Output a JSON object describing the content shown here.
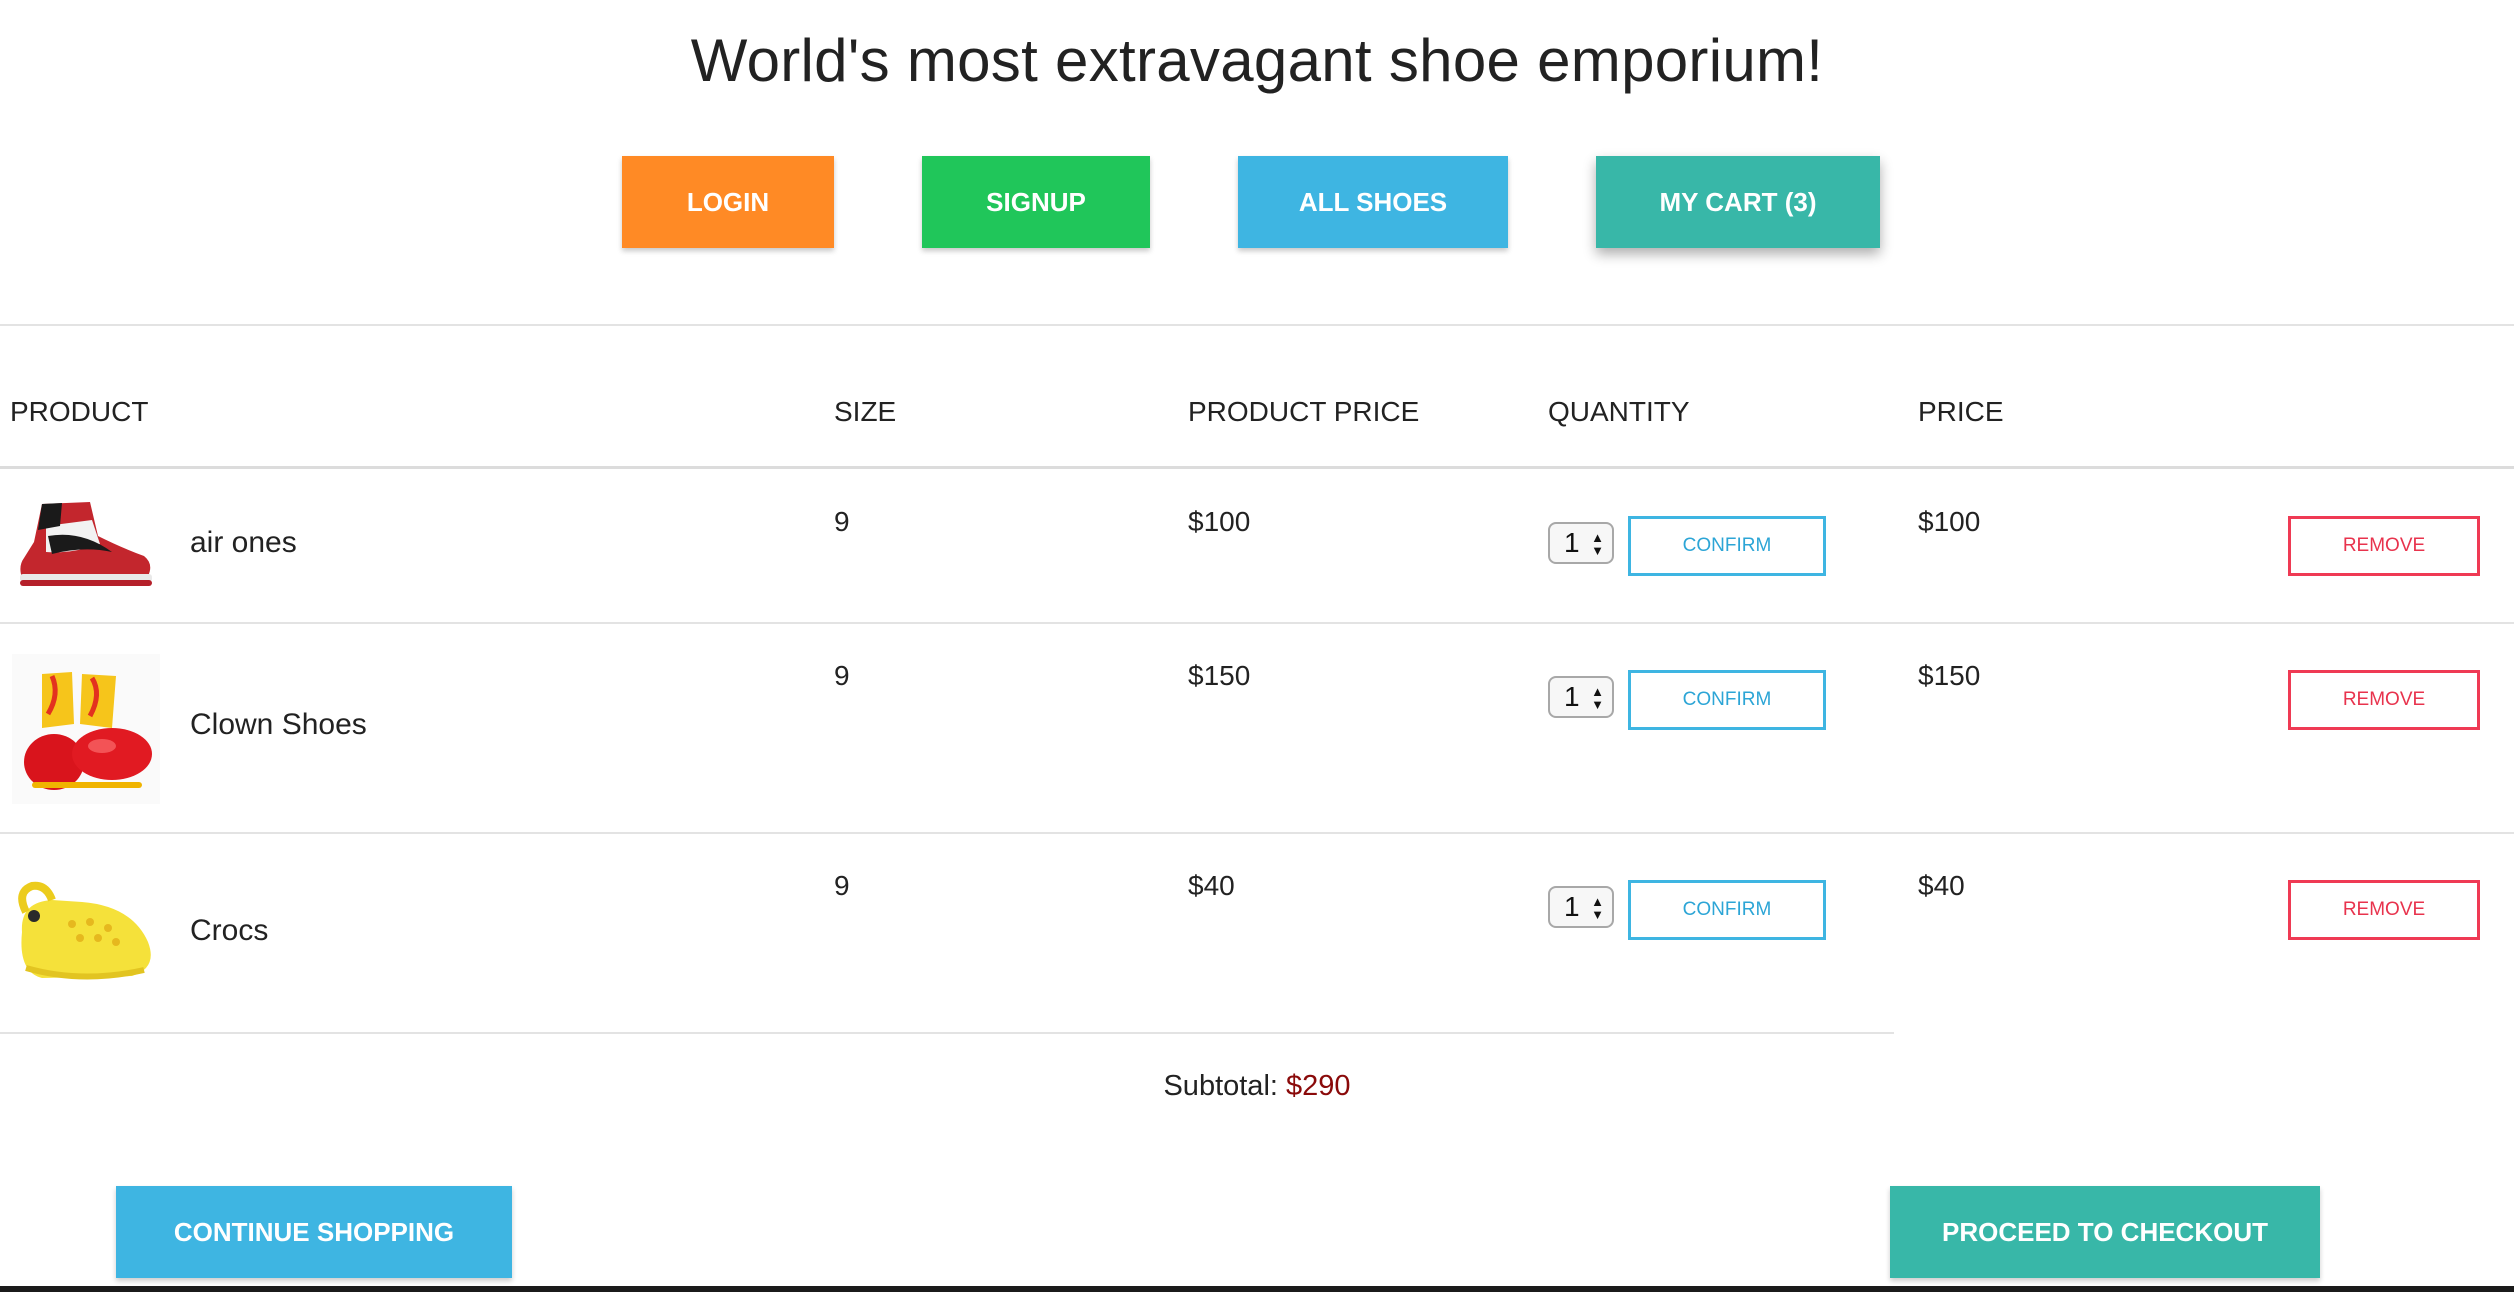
{
  "header": {
    "title": "World's most extravagant shoe emporium!"
  },
  "nav": {
    "login": "LOGIN",
    "signup": "SIGNUP",
    "all_shoes": "ALL SHOES",
    "my_cart": "MY CART (3)"
  },
  "table": {
    "headers": {
      "product": "PRODUCT",
      "size": "SIZE",
      "product_price": "PRODUCT PRICE",
      "quantity": "QUANTITY",
      "price": "PRICE"
    },
    "rows": [
      {
        "name": "air ones",
        "image": "red-high-top-sneaker-image",
        "size": "9",
        "product_price": "$100",
        "quantity": "1",
        "price": "$100",
        "confirm": "CONFIRM",
        "remove": "REMOVE"
      },
      {
        "name": "Clown Shoes",
        "image": "clown-shoes-image",
        "size": "9",
        "product_price": "$150",
        "quantity": "1",
        "price": "$150",
        "confirm": "CONFIRM",
        "remove": "REMOVE"
      },
      {
        "name": "Crocs",
        "image": "yellow-crocs-image",
        "size": "9",
        "product_price": "$40",
        "quantity": "1",
        "price": "$40",
        "confirm": "CONFIRM",
        "remove": "REMOVE"
      }
    ]
  },
  "summary": {
    "subtotal_label": "Subtotal:",
    "subtotal_value": "$290"
  },
  "footer": {
    "continue_shopping": "CONTINUE SHOPPING",
    "checkout": "PROCEED TO CHECKOUT"
  },
  "colors": {
    "login": "#ff8a25",
    "signup": "#20c65a",
    "all_shoes": "#3eb5e2",
    "cart": "#38b7a8",
    "confirm_border": "#3eb5e2",
    "remove_border": "#ef3a54",
    "subtotal_value": "#8a0a0a"
  }
}
